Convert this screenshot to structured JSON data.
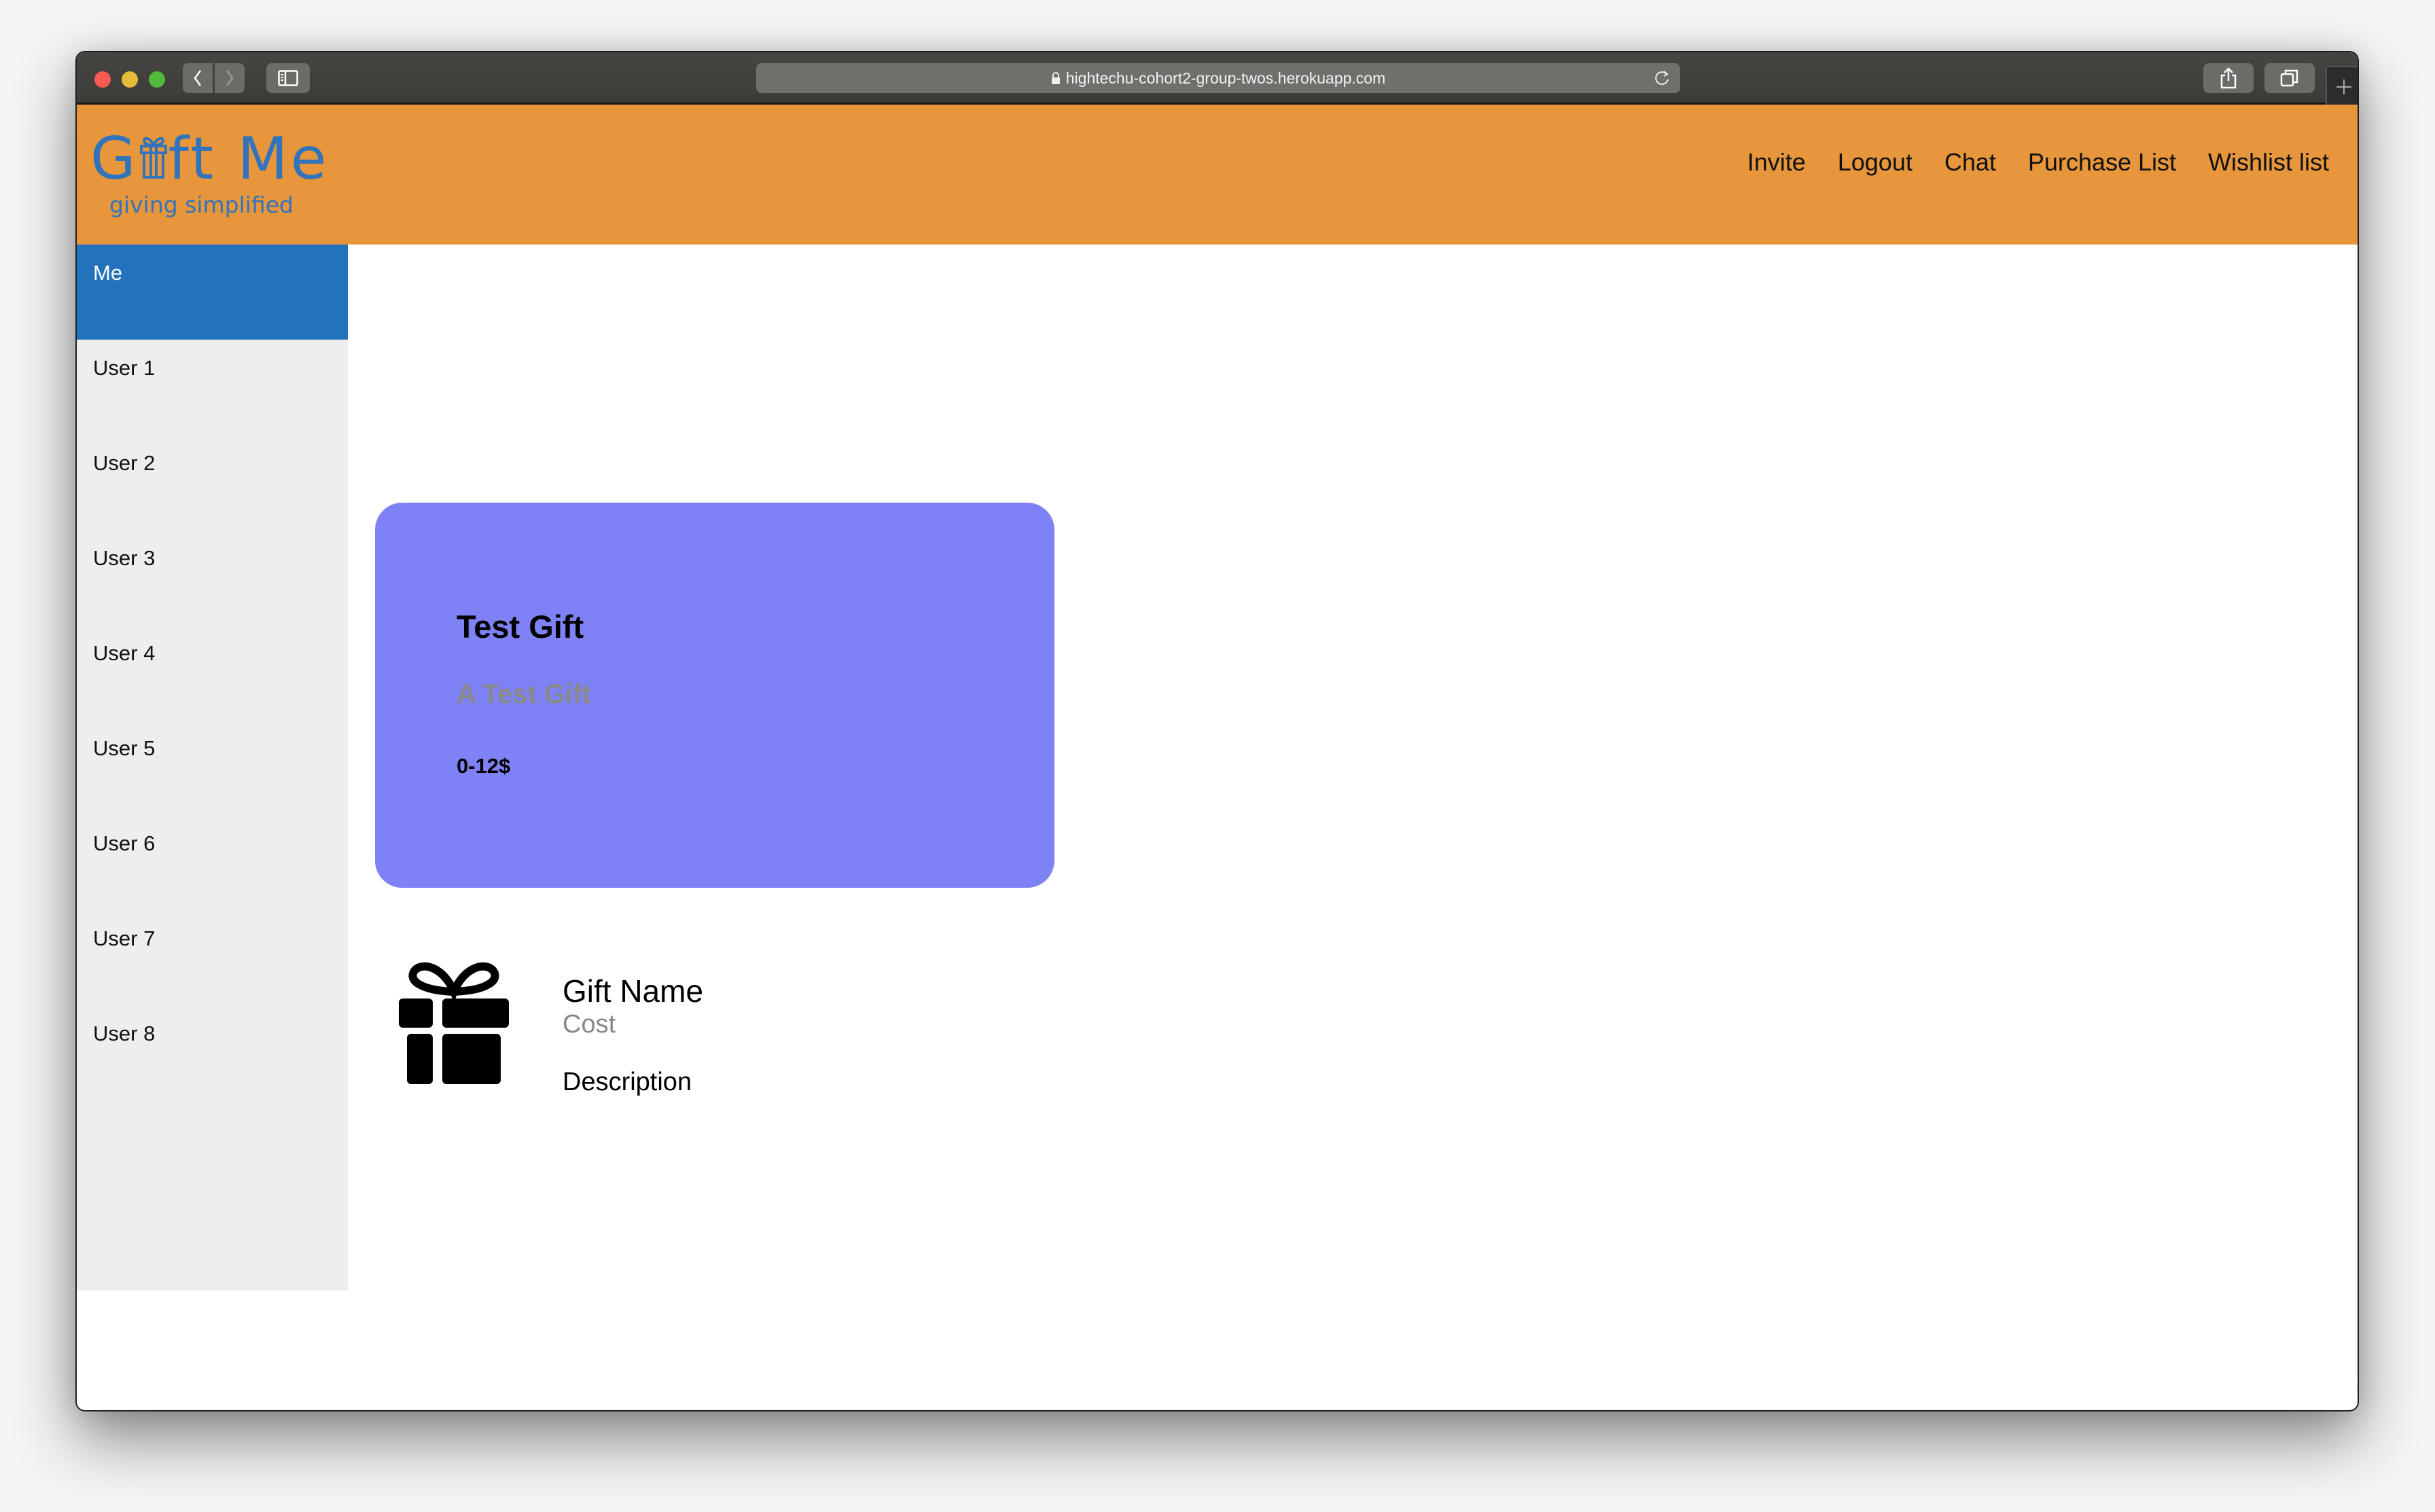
{
  "browser": {
    "url": "hightechu-cohort2-group-twos.herokuapp.com",
    "icons": {
      "back": "chevron-left-icon",
      "forward": "chevron-right-icon",
      "sidebar": "sidebar-icon",
      "lock": "lock-icon",
      "reload": "reload-icon",
      "share": "share-icon",
      "tabs": "tabs-overview-icon",
      "new_tab": "plus-icon"
    }
  },
  "header": {
    "logo_title": "Gift Me",
    "logo_tagline": "giving simplified",
    "nav": [
      {
        "label": "Invite"
      },
      {
        "label": "Logout"
      },
      {
        "label": "Chat"
      },
      {
        "label": "Purchase List"
      },
      {
        "label": "Wishlist list"
      }
    ],
    "colors": {
      "header_bg": "#e7963c",
      "logo": "#3274bc"
    }
  },
  "sidebar": {
    "active_color": "#2372bc",
    "items": [
      {
        "label": "Me",
        "active": true
      },
      {
        "label": "User 1"
      },
      {
        "label": "User 2"
      },
      {
        "label": "User 3"
      },
      {
        "label": "User 4"
      },
      {
        "label": "User 5"
      },
      {
        "label": "User 6"
      },
      {
        "label": "User 7"
      },
      {
        "label": "User 8"
      }
    ]
  },
  "gift_card": {
    "title": "Test Gift",
    "description": "A Test Gift",
    "price": "0-12$",
    "bg_color": "#7f82f5"
  },
  "gift_form": {
    "icon": "gift-icon",
    "name_label": "Gift Name",
    "cost_label": "Cost",
    "description_label": "Description"
  }
}
